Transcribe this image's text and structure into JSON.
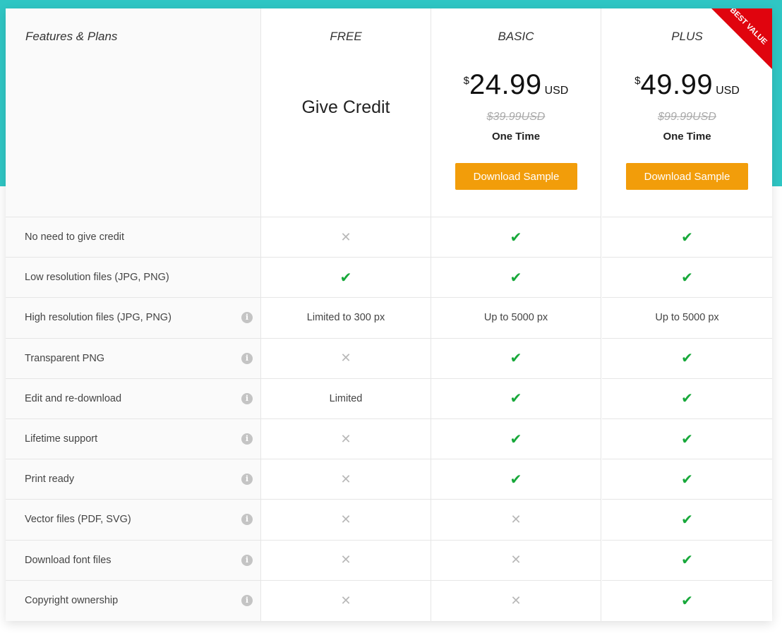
{
  "header": {
    "features_title": "Features & Plans"
  },
  "colors": {
    "accent_teal": "#2fc6c4",
    "button_orange": "#f29d0a",
    "ribbon_red": "#e0040e",
    "check_green": "#17a83a",
    "cross_gray": "#b8b8b8"
  },
  "plans": [
    {
      "name": "FREE",
      "headline": "Give Credit"
    },
    {
      "name": "BASIC",
      "currency_symbol": "$",
      "price": "24.99",
      "currency": "USD",
      "old_price": "$39.99USD",
      "billing": "One Time",
      "button_label": "Download Sample"
    },
    {
      "name": "PLUS",
      "currency_symbol": "$",
      "price": "49.99",
      "currency": "USD",
      "old_price": "$99.99USD",
      "billing": "One Time",
      "button_label": "Download Sample",
      "ribbon": "BEST VALUE"
    }
  ],
  "icons": {
    "check": "✔",
    "cross": "✕",
    "info": "i"
  },
  "features": [
    {
      "label": "No need to give credit",
      "info": false,
      "values": [
        "cross",
        "check",
        "check"
      ]
    },
    {
      "label": "Low resolution files (JPG, PNG)",
      "info": false,
      "values": [
        "check",
        "check",
        "check"
      ]
    },
    {
      "label": "High resolution files (JPG, PNG)",
      "info": true,
      "values": [
        "Limited to 300 px",
        "Up to 5000 px",
        "Up to 5000 px"
      ]
    },
    {
      "label": "Transparent PNG",
      "info": true,
      "values": [
        "cross",
        "check",
        "check"
      ]
    },
    {
      "label": "Edit and re-download",
      "info": true,
      "values": [
        "Limited",
        "check",
        "check"
      ]
    },
    {
      "label": "Lifetime support",
      "info": true,
      "values": [
        "cross",
        "check",
        "check"
      ]
    },
    {
      "label": "Print ready",
      "info": true,
      "values": [
        "cross",
        "check",
        "check"
      ]
    },
    {
      "label": "Vector files (PDF, SVG)",
      "info": true,
      "values": [
        "cross",
        "cross",
        "check"
      ]
    },
    {
      "label": "Download font files",
      "info": true,
      "values": [
        "cross",
        "cross",
        "check"
      ]
    },
    {
      "label": "Copyright ownership",
      "info": true,
      "values": [
        "cross",
        "cross",
        "check"
      ]
    }
  ]
}
